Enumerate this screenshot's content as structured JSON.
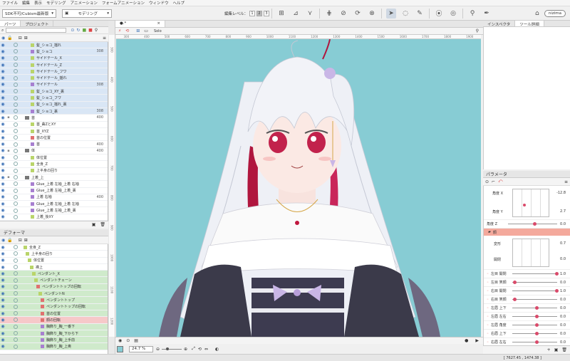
{
  "menu": [
    "ファイル",
    "編集",
    "表示",
    "モデリング",
    "アニメーション",
    "フォームアニメーション",
    "ウィンドウ",
    "ヘルプ"
  ],
  "toolbar": {
    "version_select": "SDK不可/Cubism最新版",
    "mode_select": "モデリング",
    "edit_level_label": "編集レベル：",
    "edit_level_values": [
      "1",
      "2",
      "3"
    ],
    "user": "nizima"
  },
  "left_tabs": [
    "パーツ",
    "プロジェクト"
  ],
  "parts_rows": [
    {
      "label": "髪_ショコ_揺れ",
      "num": "",
      "hl": true,
      "icon": "g"
    },
    {
      "label": "髪_ショコ",
      "num": "308",
      "hl": true,
      "icon": "p"
    },
    {
      "label": "サイドテール_X",
      "num": "",
      "hl": true,
      "icon": "g"
    },
    {
      "label": "サイドテール_Z",
      "num": "",
      "hl": true,
      "icon": "g"
    },
    {
      "label": "サイドテール_フワ",
      "num": "",
      "hl": true,
      "icon": "g"
    },
    {
      "label": "サイドテール_揺れ",
      "num": "",
      "hl": true,
      "icon": "g"
    },
    {
      "label": "サイドテール",
      "num": "308",
      "hl": true,
      "icon": "p"
    },
    {
      "label": "髪_ショコ_XY_裏",
      "num": "",
      "hl": true,
      "icon": "g"
    },
    {
      "label": "髪_ショコ_フワ",
      "num": "",
      "hl": true,
      "icon": "g"
    },
    {
      "label": "髪_ショコ_揺れ_裏",
      "num": "",
      "hl": true,
      "icon": "g"
    },
    {
      "label": "髪_ショコ_裏",
      "num": "308",
      "hl": true,
      "icon": "p"
    },
    {
      "label": "首",
      "num": "400",
      "hl": false,
      "icon": "f"
    },
    {
      "label": "首_曲ZとXY",
      "num": "",
      "hl": false,
      "icon": "g"
    },
    {
      "label": "首_XYZ",
      "num": "",
      "hl": false,
      "icon": "g"
    },
    {
      "label": "首の位置",
      "num": "",
      "hl": false,
      "icon": "d"
    },
    {
      "label": "首",
      "num": "400",
      "hl": false,
      "icon": "p"
    },
    {
      "label": "体",
      "num": "400",
      "hl": false,
      "icon": "f"
    },
    {
      "label": "体位置",
      "num": "",
      "hl": false,
      "icon": "g"
    },
    {
      "label": "全身_Z",
      "num": "",
      "hl": false,
      "icon": "g"
    },
    {
      "label": "上半身の回り",
      "num": "",
      "hl": false,
      "icon": "g"
    },
    {
      "label": "上着_上",
      "num": "",
      "hl": false,
      "icon": "f"
    },
    {
      "label": "Glue_上着 左袖_上着 右袖",
      "num": "",
      "hl": false,
      "icon": "p"
    },
    {
      "label": "Glue_上着 左袖_上着_裏",
      "num": "",
      "hl": false,
      "icon": "p"
    },
    {
      "label": "上着 右袖",
      "num": "400",
      "hl": false,
      "icon": "p"
    },
    {
      "label": "Glue_上着 左袖_上着 左袖",
      "num": "",
      "hl": false,
      "icon": "p"
    },
    {
      "label": "Glue_上着 左袖_上着_裏",
      "num": "",
      "hl": false,
      "icon": "p"
    },
    {
      "label": "上着_後XY",
      "num": "",
      "hl": false,
      "icon": "g"
    }
  ],
  "deformer_title": "デフォーマ",
  "deformer_rows": [
    {
      "label": "全身_Z",
      "hl": false,
      "icon": "g"
    },
    {
      "label": "上半身の回り",
      "hl": false,
      "icon": "g"
    },
    {
      "label": "体位置",
      "hl": false,
      "icon": "g"
    },
    {
      "label": "襟上",
      "hl": false,
      "icon": "g"
    },
    {
      "label": "ペンダント_X",
      "hl": true,
      "icon": "g"
    },
    {
      "label": "ペンダントチェーン",
      "hl": true,
      "icon": "g"
    },
    {
      "label": "ペンダントトップの回転",
      "hl": true,
      "icon": "d"
    },
    {
      "label": "ペンダントN",
      "hl": true,
      "icon": "g"
    },
    {
      "label": "ペンダントトップ",
      "hl": true,
      "icon": "d"
    },
    {
      "label": "ペンダントトップの回転",
      "hl": true,
      "icon": "d"
    },
    {
      "label": "首の位置",
      "hl": true,
      "icon": "d"
    },
    {
      "label": "顔の回転",
      "hl": false,
      "icon": "d"
    },
    {
      "label": "胸飾り_胸_一番下",
      "hl": true,
      "icon": "p"
    },
    {
      "label": "胸飾り_胸_下から下",
      "hl": true,
      "icon": "p"
    },
    {
      "label": "胸飾り_胸_上手前",
      "hl": true,
      "icon": "p"
    },
    {
      "label": "胸飾り_胸_上奥",
      "hl": true,
      "icon": "p"
    }
  ],
  "canvas": {
    "tab": "●.*",
    "solo": "Solo",
    "zoom": "24.7 %",
    "ruler_marks": [
      "300",
      "400",
      "500",
      "600",
      "700",
      "800",
      "900",
      "1000",
      "1100",
      "1200",
      "1300",
      "1400",
      "1500",
      "1600",
      "1700",
      "1800",
      "1900"
    ],
    "vruler_marks": [
      "300",
      "400",
      "500",
      "600",
      "700",
      "800",
      "900",
      "1000",
      "1100",
      "1200"
    ]
  },
  "right_tabs": [
    "インスペクタ",
    "ツール詳細"
  ],
  "param_title": "パラメータ",
  "xy": {
    "x_label": "角度 X",
    "y_label": "角度 Y",
    "x_val": "-12.8",
    "y_val": "2.7",
    "z_label": "角度 Z",
    "z_val": "0.0"
  },
  "group_label": "顔",
  "deform": {
    "a_label": "変形",
    "a_val": "0.7",
    "b_label": "開閉",
    "b_val": "0.0"
  },
  "params": [
    {
      "name": "左目 開閉",
      "val": "1.0",
      "pos": 0.96
    },
    {
      "name": "左目 笑顔",
      "val": "0.0",
      "pos": 0.02
    },
    {
      "name": "右目 開閉",
      "val": "1.0",
      "pos": 0.96
    },
    {
      "name": "右目 笑顔",
      "val": "0.0",
      "pos": 0.02
    },
    {
      "name": "左眉 上下",
      "val": "0.0",
      "pos": 0.5
    },
    {
      "name": "左眉 左右",
      "val": "0.0",
      "pos": 0.5
    },
    {
      "name": "左眉 角度",
      "val": "0.0",
      "pos": 0.5
    },
    {
      "name": "右眉 上下",
      "val": "0.0",
      "pos": 0.5
    },
    {
      "name": "右眉 左右",
      "val": "0.0",
      "pos": 0.5
    },
    {
      "name": "右眉 角度",
      "val": "0.0",
      "pos": 0.5
    }
  ],
  "status": "[ 7627.45 , 1474.38 ]"
}
